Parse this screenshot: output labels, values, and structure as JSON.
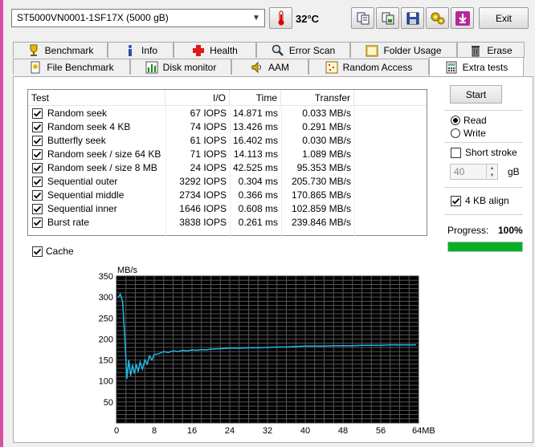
{
  "drive": {
    "name": "ST5000VN0001-1SF17X (5000 gB)"
  },
  "temperature": "32°C",
  "toolbar": {
    "exit_label": "Exit"
  },
  "tabs_row1": [
    "Benchmark",
    "Info",
    "Health",
    "Error Scan",
    "Folder Usage",
    "Erase"
  ],
  "tabs_row2": [
    "File Benchmark",
    "Disk monitor",
    "AAM",
    "Random Access",
    "Extra tests"
  ],
  "active_tab": "Extra tests",
  "table": {
    "headers": [
      "Test",
      "I/O",
      "Time",
      "Transfer"
    ],
    "rows": [
      {
        "test": "Random seek",
        "io": "67 IOPS",
        "time": "14.871 ms",
        "transfer": "0.033 MB/s",
        "checked": true
      },
      {
        "test": "Random seek 4 KB",
        "io": "74 IOPS",
        "time": "13.426 ms",
        "transfer": "0.291 MB/s",
        "checked": true
      },
      {
        "test": "Butterfly seek",
        "io": "61 IOPS",
        "time": "16.402 ms",
        "transfer": "0.030 MB/s",
        "checked": true
      },
      {
        "test": "Random seek / size 64 KB",
        "io": "71 IOPS",
        "time": "14.113 ms",
        "transfer": "1.089 MB/s",
        "checked": true
      },
      {
        "test": "Random seek / size 8 MB",
        "io": "24 IOPS",
        "time": "42.525 ms",
        "transfer": "95.353 MB/s",
        "checked": true
      },
      {
        "test": "Sequential outer",
        "io": "3292 IOPS",
        "time": "0.304 ms",
        "transfer": "205.730 MB/s",
        "checked": true
      },
      {
        "test": "Sequential middle",
        "io": "2734 IOPS",
        "time": "0.366 ms",
        "transfer": "170.865 MB/s",
        "checked": true
      },
      {
        "test": "Sequential inner",
        "io": "1646 IOPS",
        "time": "0.608 ms",
        "transfer": "102.859 MB/s",
        "checked": true
      },
      {
        "test": "Burst rate",
        "io": "3838 IOPS",
        "time": "0.261 ms",
        "transfer": "239.846 MB/s",
        "checked": true
      }
    ]
  },
  "controls": {
    "start_label": "Start",
    "read_label": "Read",
    "write_label": "Write",
    "mode": "Read",
    "short_stroke_label": "Short stroke",
    "short_stroke_checked": false,
    "short_stroke_value": "40",
    "short_stroke_unit": "gB",
    "align_label": "4 KB align",
    "align_checked": true,
    "progress_label": "Progress:",
    "progress_value": "100%",
    "progress_fraction": 1.0,
    "cache_label": "Cache",
    "cache_checked": true
  },
  "colors": {
    "progress": "#06b025",
    "chart_bg": "#000000",
    "chart_line": "#20b8e8",
    "grid": "#555555"
  },
  "chart_data": {
    "type": "line",
    "ylabel": "MB/s",
    "x_unit": "MB",
    "xlim": [
      0,
      64
    ],
    "ylim": [
      0,
      350
    ],
    "xticks": [
      0,
      8,
      16,
      24,
      32,
      40,
      48,
      56,
      64
    ],
    "xtick_labels": [
      "0",
      "8",
      "16",
      "24",
      "32",
      "40",
      "48",
      "56",
      "64MB"
    ],
    "yticks": [
      50,
      100,
      150,
      200,
      250,
      300,
      350
    ],
    "grid": true,
    "series": [
      {
        "x": [
          0.3,
          0.8,
          1.3,
          1.8,
          2.2,
          2.6,
          3.0,
          3.4,
          3.8,
          4.2,
          4.6,
          5.0,
          5.5,
          6.0,
          6.5,
          7.0,
          7.5,
          8.0,
          9,
          10,
          11,
          12,
          13,
          14,
          15,
          16,
          17,
          18,
          19,
          20,
          22,
          24,
          26,
          28,
          30,
          32,
          34,
          36,
          38,
          40,
          42,
          44,
          46,
          48,
          50,
          52,
          54,
          56,
          58,
          60,
          62,
          63.5
        ],
        "y": [
          298,
          307,
          290,
          195,
          105,
          150,
          112,
          138,
          118,
          140,
          122,
          145,
          128,
          150,
          140,
          160,
          150,
          163,
          165,
          170,
          168,
          172,
          170,
          173,
          172,
          174,
          173,
          175,
          174,
          176,
          177,
          178,
          178,
          179,
          179,
          180,
          181,
          181,
          182,
          183,
          183,
          183,
          184,
          184,
          184,
          185,
          185,
          185,
          186,
          186,
          186,
          186
        ]
      }
    ]
  }
}
